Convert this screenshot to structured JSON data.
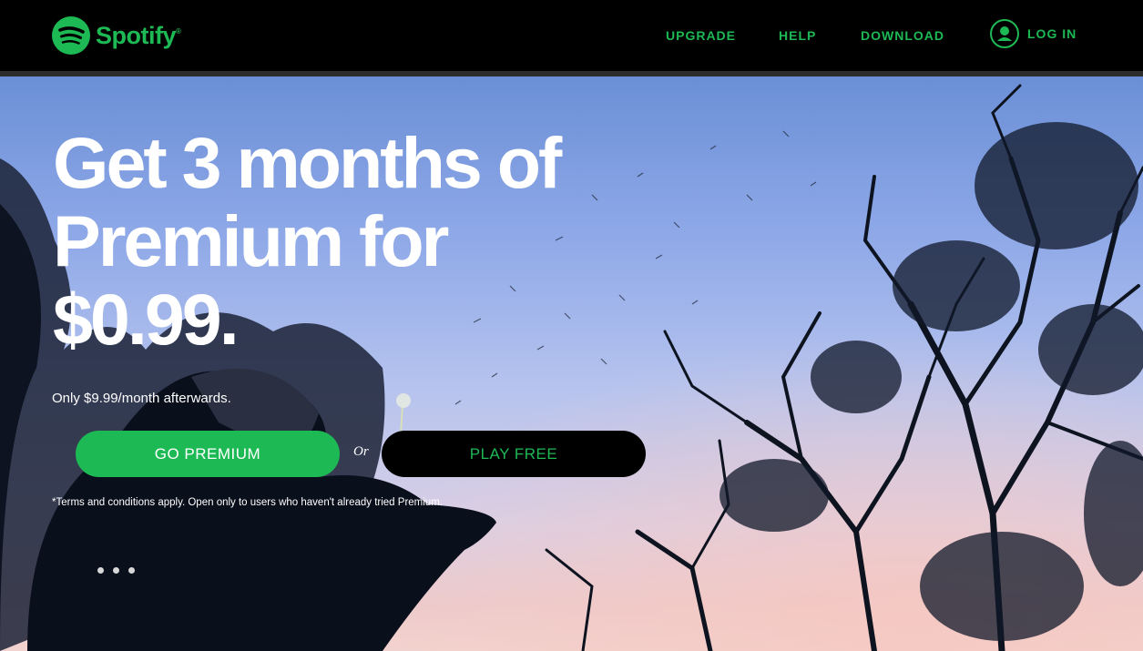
{
  "brand": {
    "name": "Spotify",
    "trademark": "®",
    "color": "#1db954"
  },
  "nav": {
    "upgrade": "UPGRADE",
    "help": "HELP",
    "download": "DOWNLOAD",
    "login": "LOG IN"
  },
  "hero": {
    "headline_line1": "Get 3 months of",
    "headline_line2": "Premium for",
    "headline_line3": "$0.99.",
    "subline": "Only $9.99/month afterwards.",
    "go_premium": "GO PREMIUM",
    "or": "Or",
    "play_free": "PLAY FREE",
    "terms": "*Terms and conditions apply. Open only to users who haven't already tried Premium."
  },
  "carousel": {
    "slides": 3
  }
}
